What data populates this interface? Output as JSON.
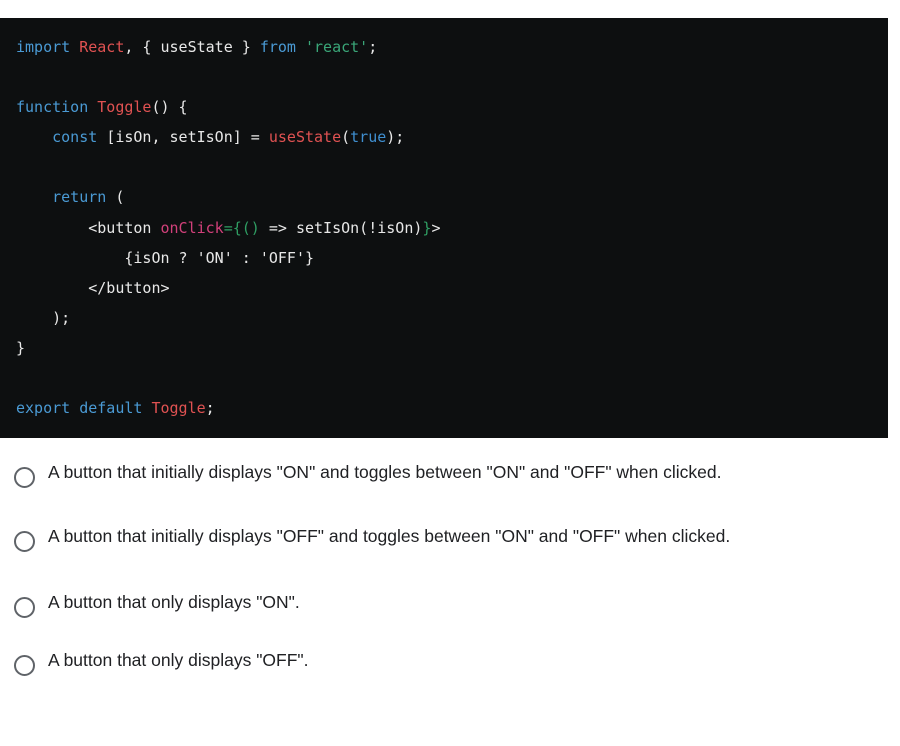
{
  "code_block": {
    "language": "jsx",
    "background": "#0d0f10",
    "lines": [
      [
        {
          "t": "import ",
          "c": "kw"
        },
        {
          "t": "React",
          "c": "cls"
        },
        {
          "t": ", { useState } ",
          "c": "plain"
        },
        {
          "t": "from ",
          "c": "kw"
        },
        {
          "t": "'react'",
          "c": "str"
        },
        {
          "t": ";",
          "c": "plain"
        }
      ],
      [],
      [
        {
          "t": "function ",
          "c": "kw"
        },
        {
          "t": "Toggle",
          "c": "cls"
        },
        {
          "t": "() {",
          "c": "plain"
        }
      ],
      [
        {
          "t": "    const ",
          "c": "kw"
        },
        {
          "t": "[isOn, setIsOn] = ",
          "c": "plain"
        },
        {
          "t": "useState",
          "c": "cls"
        },
        {
          "t": "(",
          "c": "plain"
        },
        {
          "t": "true",
          "c": "bool"
        },
        {
          "t": ");",
          "c": "plain"
        }
      ],
      [],
      [
        {
          "t": "    return ",
          "c": "kw"
        },
        {
          "t": "(",
          "c": "plain"
        }
      ],
      [
        {
          "t": "        <button ",
          "c": "plain"
        },
        {
          "t": "onClick",
          "c": "attr"
        },
        {
          "t": "={()",
          "c": "punct"
        },
        {
          "t": " => setIsOn(!isOn)",
          "c": "plain"
        },
        {
          "t": "}",
          "c": "punct"
        },
        {
          "t": ">",
          "c": "plain"
        }
      ],
      [
        {
          "t": "            {isOn ? 'ON' : 'OFF'}",
          "c": "plain"
        }
      ],
      [
        {
          "t": "        </button>",
          "c": "plain"
        }
      ],
      [
        {
          "t": "    );",
          "c": "plain"
        }
      ],
      [
        {
          "t": "}",
          "c": "plain"
        }
      ],
      [],
      [
        {
          "t": "export default ",
          "c": "kw"
        },
        {
          "t": "Toggle",
          "c": "cls"
        },
        {
          "t": ";",
          "c": "plain"
        }
      ]
    ],
    "plain_text": "import React, { useState } from 'react';\n\nfunction Toggle() {\n    const [isOn, setIsOn] = useState(true);\n\n    return (\n        <button onClick={() => setIsOn(!isOn)}>\n            {isOn ? 'ON' : 'OFF'}\n        </button>\n    );\n}\n\nexport default Toggle;",
    "colors": {
      "keyword": "#4a9ad4",
      "class_name": "#e05252",
      "string": "#3aa678",
      "attribute": "#d1407a",
      "punctuation": "#2f9e63",
      "boolean": "#3f8fd0",
      "plain": "#e8e8e8"
    }
  },
  "question": {
    "selected_index": null,
    "options": [
      {
        "id": "opt-0",
        "label": "A button that initially displays \"ON\" and toggles between \"ON\" and \"OFF\" when clicked.",
        "selected": false
      },
      {
        "id": "opt-1",
        "label": "A button that initially displays \"OFF\" and toggles between \"ON\" and \"OFF\" when clicked.",
        "selected": false
      },
      {
        "id": "opt-2",
        "label": "A button that only displays \"ON\".",
        "selected": false
      },
      {
        "id": "opt-3",
        "label": "A button that only displays \"OFF\".",
        "selected": false
      }
    ]
  },
  "theme": {
    "page_background": "#ffffff",
    "text_color": "#202124",
    "radio_border": "#5f6368"
  }
}
